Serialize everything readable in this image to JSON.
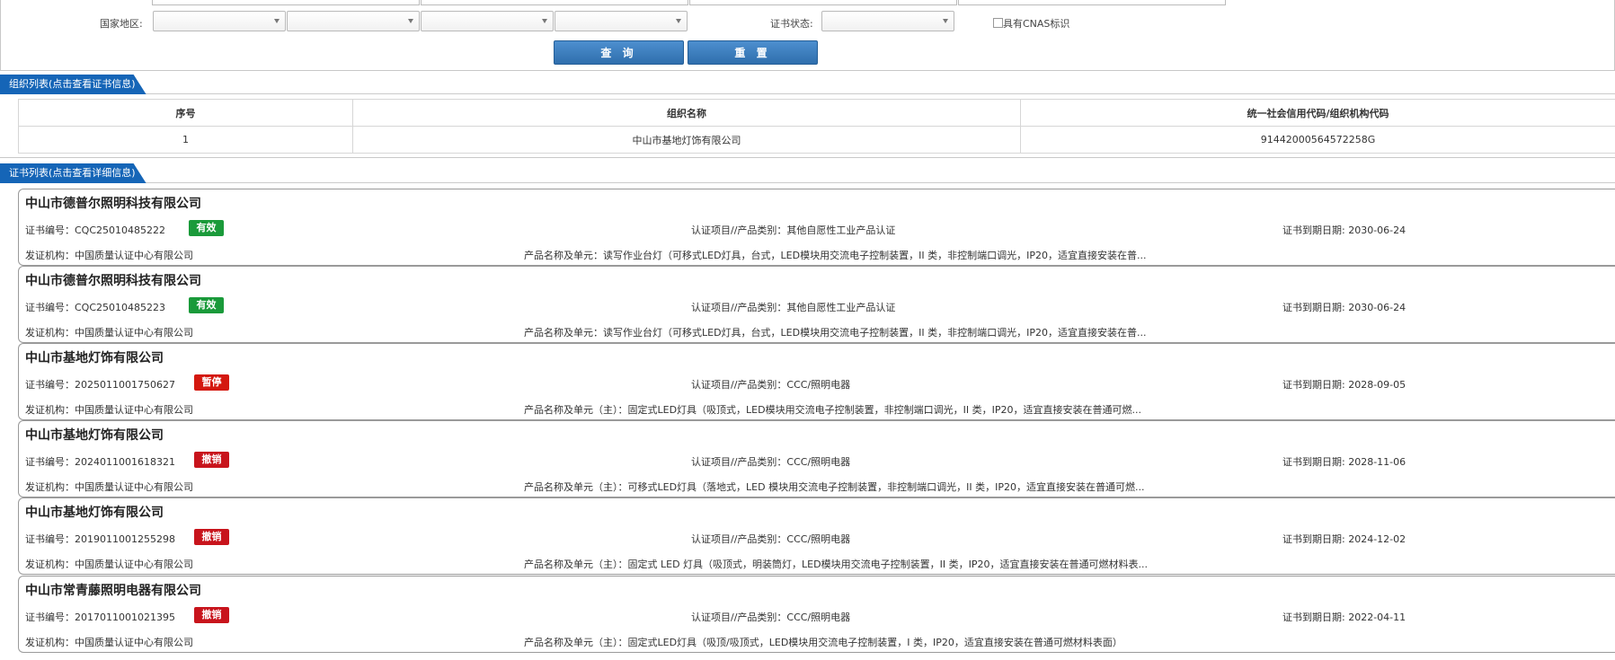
{
  "search": {
    "country_label": "国家地区:",
    "status_label": "证书状态:",
    "cnas_label": "具有CNAS标识",
    "query_button": "查 询",
    "reset_button": "重 置"
  },
  "org_section": {
    "title": "组织列表(点击查看证书信息)",
    "columns": [
      "序号",
      "组织名称",
      "统一社会信用代码/组织机构代码"
    ],
    "rows": [
      {
        "index": "1",
        "name": "中山市基地灯饰有限公司",
        "code": "91442000564572258G"
      }
    ]
  },
  "cert_section": {
    "title": "证书列表(点击查看详细信息)",
    "items": [
      {
        "org": "中山市德普尔照明科技有限公司",
        "cert_no": "证书编号：CQC25010485222",
        "status": "有效",
        "project": "认证项目//产品类别：其他自愿性工业产品认证",
        "expiry": "证书到期日期: 2030-06-24",
        "issuer": "发证机构：中国质量认证中心有限公司",
        "product": "产品名称及单元：读写作业台灯（可移式LED灯具，台式，LED模块用交流电子控制装置，II 类，非控制端口调光，IP20，适宜直接安装在普..."
      },
      {
        "org": "中山市德普尔照明科技有限公司",
        "cert_no": "证书编号：CQC25010485223",
        "status": "有效",
        "project": "认证项目//产品类别：其他自愿性工业产品认证",
        "expiry": "证书到期日期: 2030-06-24",
        "issuer": "发证机构：中国质量认证中心有限公司",
        "product": "产品名称及单元：读写作业台灯（可移式LED灯具，台式，LED模块用交流电子控制装置，II 类，非控制端口调光，IP20，适宜直接安装在普..."
      },
      {
        "org": "中山市基地灯饰有限公司",
        "cert_no": "证书编号：2025011001750627",
        "status": "暂停",
        "project": "认证项目//产品类别：CCC/照明电器",
        "expiry": "证书到期日期: 2028-09-05",
        "issuer": "发证机构：中国质量认证中心有限公司",
        "product": "产品名称及单元（主）：固定式LED灯具（吸顶式，LED模块用交流电子控制装置，非控制端口调光，II 类，IP20，适宜直接安装在普通可燃..."
      },
      {
        "org": "中山市基地灯饰有限公司",
        "cert_no": "证书编号：2024011001618321",
        "status": "撤销",
        "project": "认证项目//产品类别：CCC/照明电器",
        "expiry": "证书到期日期: 2028-11-06",
        "issuer": "发证机构：中国质量认证中心有限公司",
        "product": "产品名称及单元（主）：可移式LED灯具（落地式，LED 模块用交流电子控制装置，非控制端口调光，II 类，IP20，适宜直接安装在普通可燃..."
      },
      {
        "org": "中山市基地灯饰有限公司",
        "cert_no": "证书编号：2019011001255298",
        "status": "撤销",
        "project": "认证项目//产品类别：CCC/照明电器",
        "expiry": "证书到期日期: 2024-12-02",
        "issuer": "发证机构：中国质量认证中心有限公司",
        "product": "产品名称及单元（主）：固定式 LED 灯具（吸顶式，明装筒灯，LED模块用交流电子控制装置，II 类，IP20，适宜直接安装在普通可燃材料表..."
      },
      {
        "org": "中山市常青藤照明电器有限公司",
        "cert_no": "证书编号：2017011001021395",
        "status": "撤销",
        "project": "认证项目//产品类别：CCC/照明电器",
        "expiry": "证书到期日期: 2022-04-11",
        "issuer": "发证机构：中国质量认证中心有限公司",
        "product": "产品名称及单元（主）：固定式LED灯具（吸顶/吸顶式，LED模块用交流电子控制装置，I 类，IP20，适宜直接安装在普通可燃材料表面）"
      }
    ]
  },
  "colors": {
    "accent": "#1565b7",
    "status_valid": "#1a9a3a",
    "status_suspended": "#d4180f",
    "status_revoked": "#c8141c"
  }
}
